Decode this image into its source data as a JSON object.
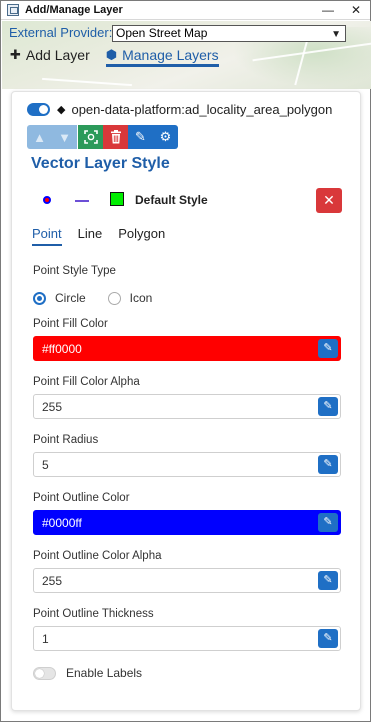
{
  "window": {
    "title": "Add/Manage Layer",
    "close_glyph": "✕"
  },
  "header": {
    "provider_label": "External Provider:",
    "provider_value": "Open Street Map",
    "tabs": [
      {
        "label": "Add Layer",
        "icon": "plus-icon",
        "active": false
      },
      {
        "label": "Manage Layers",
        "icon": "layers-icon",
        "active": true
      }
    ]
  },
  "layer": {
    "enabled": true,
    "name": "open-data-platform:ad_locality_area_polygon"
  },
  "toolbar": {
    "buttons": [
      "move-up-icon",
      "move-down-icon",
      "zoom-to-layer-icon",
      "delete-icon",
      "edit-icon",
      "settings-icon"
    ]
  },
  "style": {
    "section_title": "Vector Layer Style",
    "style_name": "Default Style",
    "symbols": {
      "point_fill": "#ff0000",
      "point_outline": "#0000ff",
      "line_color": "#6c4fd6",
      "polygon_fill": "#00ee00"
    },
    "subtabs": [
      {
        "label": "Point",
        "active": true
      },
      {
        "label": "Line",
        "active": false
      },
      {
        "label": "Polygon",
        "active": false
      }
    ]
  },
  "point": {
    "style_type_label": "Point Style Type",
    "style_type_options": [
      {
        "label": "Circle",
        "checked": true
      },
      {
        "label": "Icon",
        "checked": false
      }
    ],
    "fill_color_label": "Point Fill Color",
    "fill_color_value": "#ff0000",
    "fill_alpha_label": "Point Fill Color Alpha",
    "fill_alpha_value": "255",
    "radius_label": "Point Radius",
    "radius_value": "5",
    "outline_color_label": "Point Outline Color",
    "outline_color_value": "#0000ff",
    "outline_alpha_label": "Point Outline Color Alpha",
    "outline_alpha_value": "255",
    "outline_thickness_label": "Point Outline Thickness",
    "outline_thickness_value": "1"
  },
  "labels": {
    "enabled": false,
    "label": "Enable Labels"
  }
}
